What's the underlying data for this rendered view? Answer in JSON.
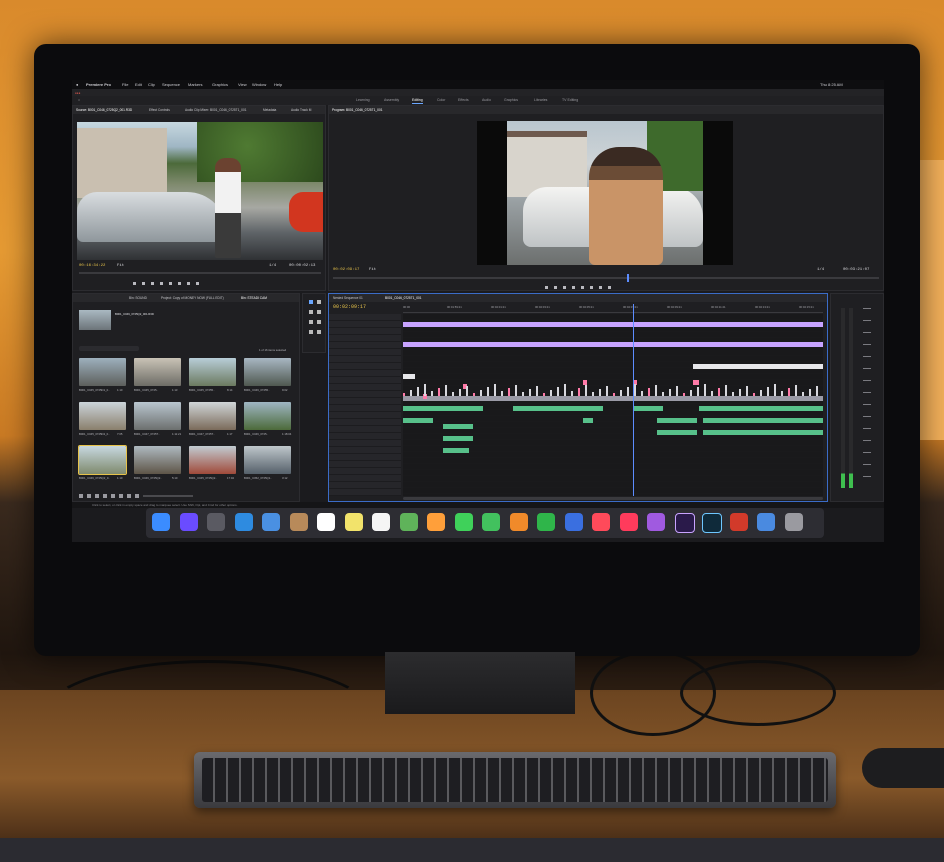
{
  "menubar": {
    "app": "Premiere Pro",
    "items": [
      "File",
      "Edit",
      "Clip",
      "Sequence",
      "Markers",
      "Graphics",
      "View",
      "Window",
      "Help"
    ],
    "clock": "Thu 8:25 AM"
  },
  "workspaces": [
    "Learning",
    "Assembly",
    "Editing",
    "Color",
    "Effects",
    "Audio",
    "Graphics",
    "Libraries",
    "TV Editing"
  ],
  "active_workspace": "Editing",
  "source_panel": {
    "tabs": [
      "Source: B001_C046_0725Q2_001.R3D",
      "Effect Controls",
      "Audio Clip Mixer: B001_C046_0725T1_001",
      "Metadata",
      "Audio Track M"
    ],
    "timecode_left": "00:16:34:22",
    "fit": "Fit",
    "ratio": "1/4",
    "timecode_right": "00:00:02:13"
  },
  "program_panel": {
    "tab": "Program: B001_C046_0725T1_001",
    "timecode_left": "00:02:09:17",
    "fit": "Fit",
    "ratio": "1/4",
    "timecode_right": "00:03:21:07"
  },
  "project_panel": {
    "tabs": [
      "Bin: SOUND",
      "Project: Copy of MONEY NOW (FULL EDIT)",
      "Bin: STEADI CAM"
    ],
    "clip_name": "B001_C046_0725Q2_001.R3D",
    "selection_status": "1 of 16 items selected",
    "thumbnails": [
      {
        "label": "B001_C045_0725D1_0..",
        "dur": "1:10"
      },
      {
        "label": "B001_C045_0725..",
        "dur": "1:13"
      },
      {
        "label": "B001_C045_07255..",
        "dur": "8:14"
      },
      {
        "label": "B001_C046_07255..",
        "dur": "9:02"
      },
      {
        "label": "B001_C045_0725D2_0..",
        "dur": "7:05"
      },
      {
        "label": "B001_C047_0725T..",
        "dur": "1:11:21"
      },
      {
        "label": "B001_C047_0725T..",
        "dur": "1:17"
      },
      {
        "label": "B001_C046_0725..",
        "dur": "1:18:04"
      },
      {
        "label": "B001_C046_0725Q2_0..",
        "dur": "1:10"
      },
      {
        "label": "B001_C046_0725Q2..",
        "dur": "5:10"
      },
      {
        "label": "B001_C045_0725Q2..",
        "dur": "17:02"
      },
      {
        "label": "B001_C052_0725Q1..",
        "dur": "3:12"
      }
    ]
  },
  "timeline": {
    "tabs": [
      "Nested Sequence 01",
      "B001_C046_0725T1_001"
    ],
    "timecode": "00:02:09:17",
    "ruler": [
      "00:00",
      "00:01:59:21",
      "00:02:01:21",
      "00:02:03:21",
      "00:02:05:21",
      "00:02:07:21",
      "00:02:09:21",
      "00:02:11:21",
      "00:02:13:21",
      "00:02:15:21"
    ]
  },
  "status_bar": "Click to select, or click in empty space and drag to marquee select. Use Shift, Opt, and Cmd for other options.",
  "colors": {
    "video_clip": "#c7a3ff",
    "audio_clip": "#57c08a",
    "marker": "#ff7aa8",
    "playhead": "#5c8cff",
    "wall": "#e59a33"
  },
  "dock_icons": [
    "finder-icon",
    "siri-icon",
    "launchpad-icon",
    "safari-icon",
    "mail-icon",
    "contacts-icon",
    "calendar-icon",
    "notes-icon",
    "reminders-icon",
    "maps-icon",
    "photos-icon",
    "messages-icon",
    "facetime-icon",
    "pages-icon",
    "numbers-icon",
    "keynote-icon",
    "news-icon",
    "music-icon",
    "podcasts-icon",
    "premiere-pro-icon",
    "lightroom-icon",
    "photobooth-icon",
    "folder-icon",
    "trash-icon"
  ]
}
